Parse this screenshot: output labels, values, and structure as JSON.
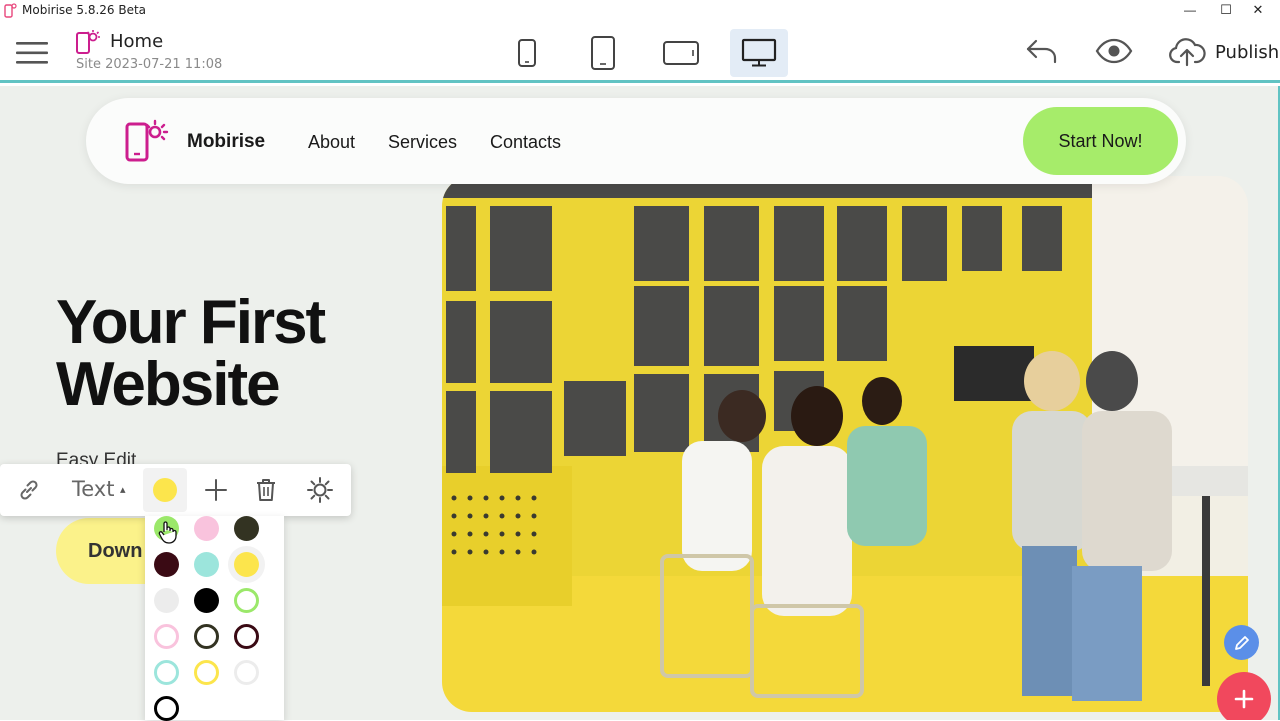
{
  "window": {
    "title": "Mobirise 5.8.26 Beta",
    "minimize_glyph": "—",
    "maximize_glyph": "☐",
    "close_glyph": "✕"
  },
  "topbar": {
    "page_name": "Home",
    "site_info": "Site 2023-07-21 11:08",
    "devices": [
      {
        "name": "mobile-small",
        "icon": "phone-small-icon",
        "active": false
      },
      {
        "name": "mobile",
        "icon": "phone-icon",
        "active": false
      },
      {
        "name": "tablet",
        "icon": "tablet-icon",
        "active": false
      },
      {
        "name": "desktop",
        "icon": "desktop-icon",
        "active": true
      }
    ],
    "publish_label": "Publish"
  },
  "navbar": {
    "brand": "Mobirise",
    "links": [
      "About",
      "Services",
      "Contacts"
    ],
    "cta": "Start Now!"
  },
  "hero": {
    "title_line1": "Your First",
    "title_line2": "Website",
    "subtitle": "Easy Edit",
    "button_label": "Down"
  },
  "text_toolbar": {
    "text_dropdown": "Text",
    "caret": "▴",
    "selected_color": "#fce54c"
  },
  "palette": {
    "colors": [
      {
        "fill": "#9be86a",
        "style": "filled"
      },
      {
        "fill": "#f9c3dd",
        "style": "filled"
      },
      {
        "fill": "#333322",
        "style": "filled"
      },
      {
        "fill": "#3a0a14",
        "style": "filled"
      },
      {
        "fill": "#9ce5dc",
        "style": "filled"
      },
      {
        "fill": "#fce54c",
        "style": "filled"
      },
      {
        "fill": "#ececec",
        "style": "filled"
      },
      {
        "fill": "#000000",
        "style": "filled"
      },
      {
        "fill": "#9be86a",
        "style": "outline"
      },
      {
        "fill": "#f9c3dd",
        "style": "outline"
      },
      {
        "fill": "#333322",
        "style": "outline"
      },
      {
        "fill": "#3a0a14",
        "style": "outline"
      },
      {
        "fill": "#9ce5dc",
        "style": "outline"
      },
      {
        "fill": "#fce54c",
        "style": "outline"
      },
      {
        "fill": "#ececec",
        "style": "outline"
      },
      {
        "fill": "#000000",
        "style": "outline"
      }
    ]
  },
  "colors": {
    "accent_teal": "#61c3c3",
    "cta_green": "#a6ec6a",
    "hero_button_yellow": "#fbf28a",
    "brand_magenta": "#cc1e8e",
    "fab_red": "#f1485d",
    "fab_blue": "#5b8fe8"
  }
}
